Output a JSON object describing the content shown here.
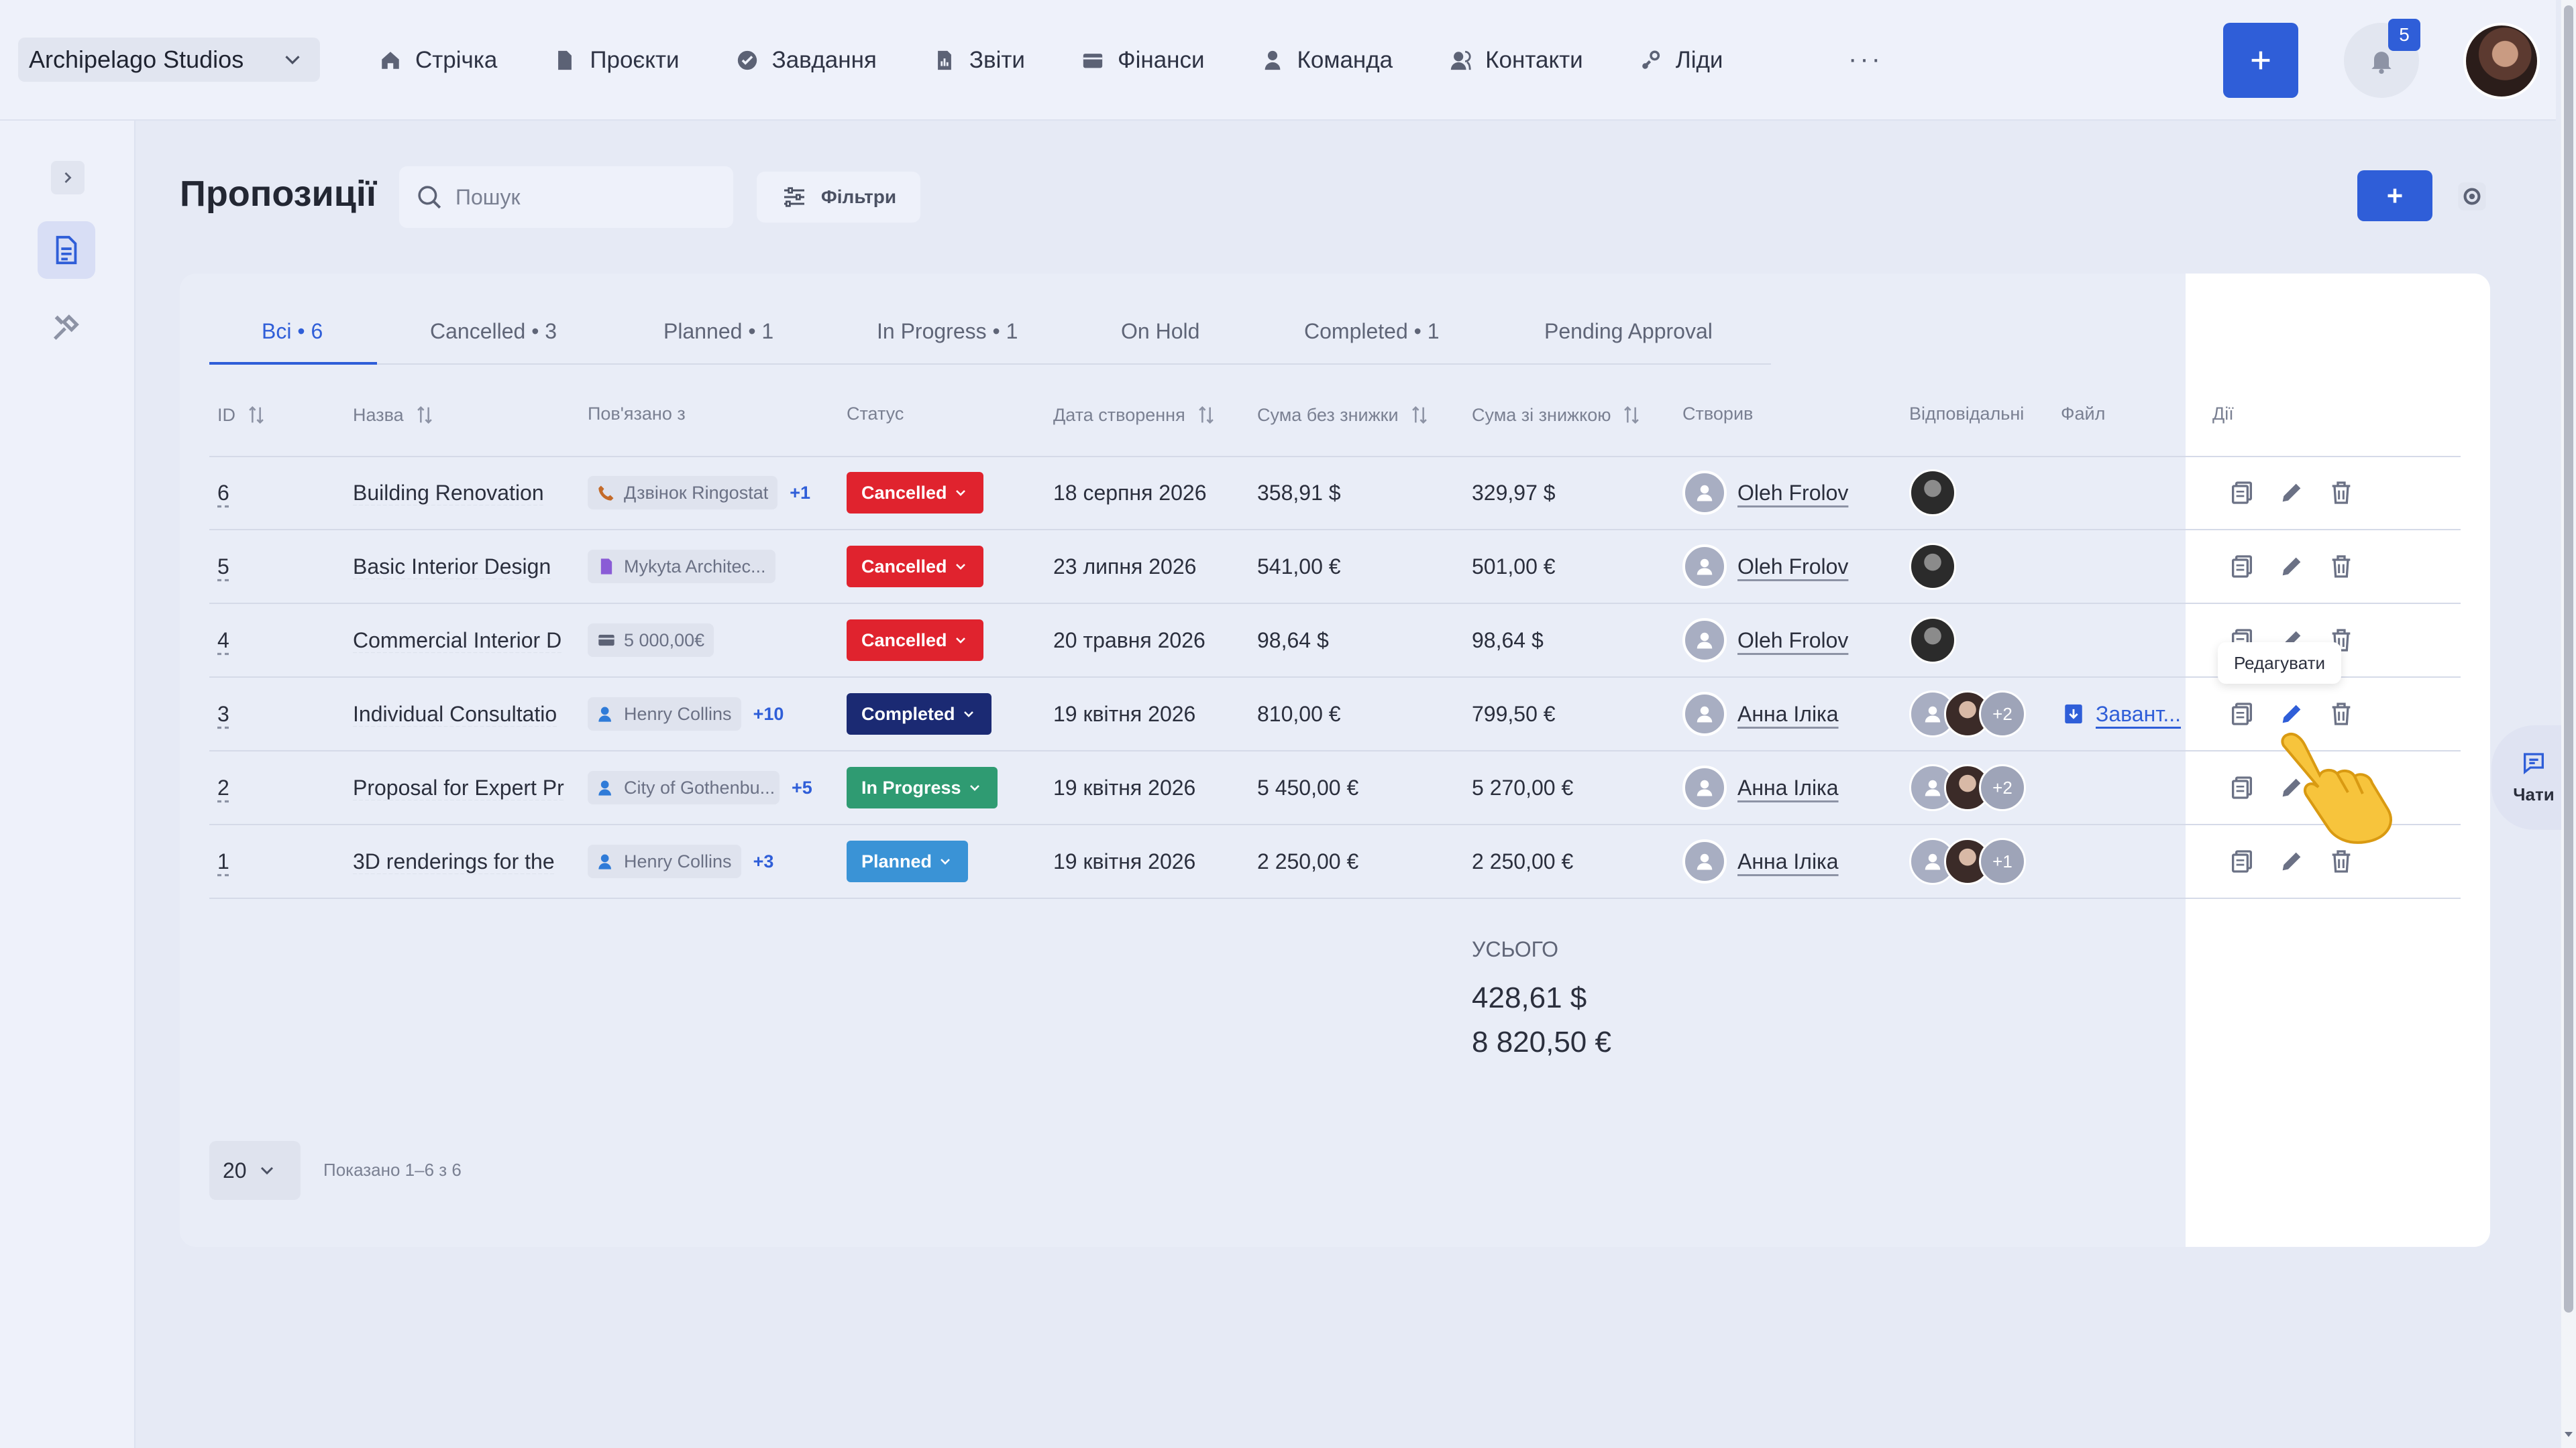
{
  "topbar": {
    "org_name": "Archipelago Studios",
    "nav": [
      "Стрічка",
      "Проєкти",
      "Завдання",
      "Звіти",
      "Фінанси",
      "Команда",
      "Контакти",
      "Ліди"
    ],
    "more": "···",
    "notification_count": "5",
    "nav_icons": [
      "home-icon",
      "file-icon",
      "check-circle-icon",
      "report-icon",
      "wallet-icon",
      "user-icon",
      "contacts-icon",
      "leads-icon"
    ]
  },
  "page": {
    "title": "Пропозиції",
    "search_placeholder": "Пошук",
    "filters_label": "Фільтри",
    "add_label": "+"
  },
  "tabs": [
    {
      "label": "Всі • 6",
      "active": true
    },
    {
      "label": "Cancelled • 3"
    },
    {
      "label": "Planned • 1"
    },
    {
      "label": "In Progress • 1"
    },
    {
      "label": "On Hold"
    },
    {
      "label": "Completed • 1"
    },
    {
      "label": "Pending Approval"
    }
  ],
  "columns": [
    "ID",
    "Назва",
    "Пов'язано з",
    "Статус",
    "Дата створення",
    "Сума без знижки",
    "Сума зі знижкою",
    "Створив",
    "Відповідальні",
    "Файл",
    "Дії"
  ],
  "rows": [
    {
      "id": "6",
      "name": "Building Renovation",
      "related": "Дзвінок Ringostat",
      "related_icon": "phone-call-icon",
      "related_more": "+1",
      "status": "Cancelled",
      "status_color": "#e0232e",
      "created": "18 серпня 2026",
      "amount": "358,91 $",
      "discounted": "329,97 $",
      "creator": "Oleh Frolov",
      "resp_more": "",
      "file": ""
    },
    {
      "id": "5",
      "name": "Basic Interior Design",
      "related": "Mykyta Architec...",
      "related_icon": "document-icon",
      "related_more": "",
      "status": "Cancelled",
      "status_color": "#e0232e",
      "created": "23 липня 2026",
      "amount": "541,00 €",
      "discounted": "501,00 €",
      "creator": "Oleh Frolov",
      "resp_more": "",
      "file": ""
    },
    {
      "id": "4",
      "name": "Commercial Interior D",
      "related": "5 000,00€",
      "related_icon": "money-icon",
      "related_more": "",
      "status": "Cancelled",
      "status_color": "#e0232e",
      "created": "20 травня 2026",
      "amount": "98,64 $",
      "discounted": "98,64 $",
      "creator": "Oleh Frolov",
      "resp_more": "",
      "file": ""
    },
    {
      "id": "3",
      "name": "Individual Consultatio",
      "related": "Henry Collins",
      "related_icon": "contact-icon",
      "related_more": "+10",
      "status": "Completed",
      "status_color": "#1b2a73",
      "created": "19 квітня 2026",
      "amount": "810,00 €",
      "discounted": "799,50 €",
      "creator": "Анна Іліка",
      "resp_more": "+2",
      "file": "Завант..."
    },
    {
      "id": "2",
      "name": "Proposal for Expert Pr",
      "related": "City of Gothenbu...",
      "related_icon": "contact-icon",
      "related_more": "+5",
      "status": "In Progress",
      "status_color": "#2f9b72",
      "created": "19 квітня 2026",
      "amount": "5 450,00 €",
      "discounted": "5 270,00 €",
      "creator": "Анна Іліка",
      "resp_more": "+2",
      "file": ""
    },
    {
      "id": "1",
      "name": "3D renderings for the",
      "related": "Henry Collins",
      "related_icon": "contact-icon",
      "related_more": "+3",
      "status": "Planned",
      "status_color": "#3a93d6",
      "created": "19 квітня 2026",
      "amount": "2 250,00 €",
      "discounted": "2 250,00 €",
      "creator": "Анна Іліка",
      "resp_more": "+1",
      "file": ""
    }
  ],
  "tooltip": "Редагувати",
  "totals": {
    "label": "УСЬОГО",
    "usd": "428,61 $",
    "eur": "8 820,50 €"
  },
  "pagination": {
    "per_page": "20",
    "shown": "Показано 1–6 з 6"
  },
  "chats_label": "Чати",
  "colors": {
    "accent": "#2f5ed8",
    "cancelled": "#e0232e",
    "completed": "#1b2a73",
    "in_progress": "#2f9b72",
    "planned": "#3a93d6"
  }
}
